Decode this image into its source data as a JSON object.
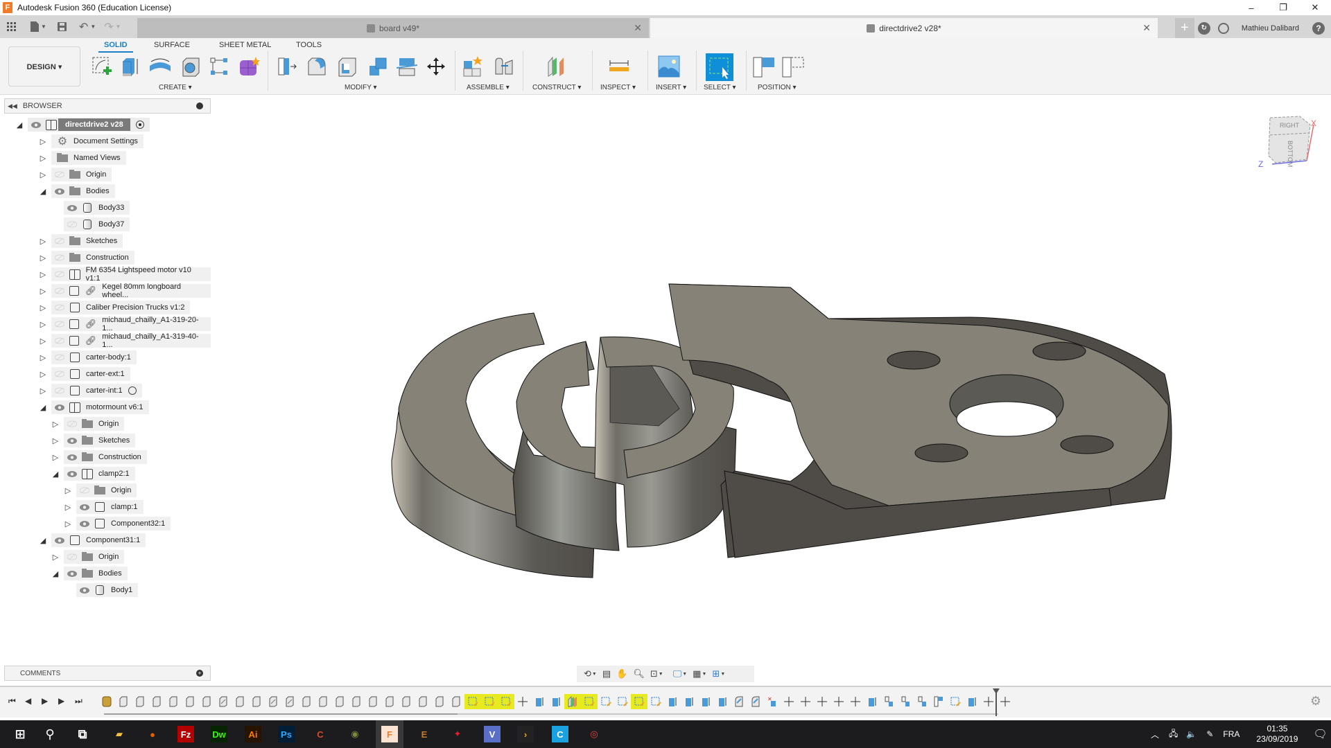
{
  "window": {
    "title": "Autodesk Fusion 360 (Education License)",
    "app_icon_letter": "F",
    "controls": {
      "minimize": "–",
      "maximize": "❐",
      "close": "✕"
    }
  },
  "tabs": [
    {
      "label": "board v49*",
      "active": false,
      "close": "✕"
    },
    {
      "label": "directdrive2 v28*",
      "active": true,
      "close": "✕"
    }
  ],
  "tabbar_right": {
    "user_name": "Mathieu Dalibard",
    "help": "?"
  },
  "toolbar": {
    "workspace": "DESIGN ▾",
    "ribbon_tabs": [
      "SOLID",
      "SURFACE",
      "SHEET METAL",
      "TOOLS"
    ],
    "active_ribbon_tab": "SOLID",
    "groups": [
      {
        "label": "CREATE ▾"
      },
      {
        "label": "MODIFY ▾"
      },
      {
        "label": "ASSEMBLE ▾"
      },
      {
        "label": "CONSTRUCT ▾"
      },
      {
        "label": "INSPECT ▾"
      },
      {
        "label": "INSERT ▾"
      },
      {
        "label": "SELECT ▾"
      },
      {
        "label": "POSITION ▾"
      }
    ]
  },
  "browser": {
    "title": "BROWSER",
    "tree": [
      {
        "label": "directdrive2 v28",
        "expanded": true,
        "visible": true,
        "icon": "assembly-icon",
        "root": true
      },
      {
        "label": "Document Settings",
        "expanded": false,
        "icon": "gear-icon"
      },
      {
        "label": "Named Views",
        "expanded": false,
        "icon": "folder-icon"
      },
      {
        "label": "Origin",
        "expanded": false,
        "visible": false,
        "icon": "folder-icon"
      },
      {
        "label": "Bodies",
        "expanded": true,
        "visible": true,
        "icon": "folder-icon"
      },
      {
        "label": "Body33",
        "visible": true,
        "icon": "body-icon"
      },
      {
        "label": "Body37",
        "visible": false,
        "icon": "body-icon"
      },
      {
        "label": "Sketches",
        "expanded": false,
        "visible": false,
        "icon": "folder-icon"
      },
      {
        "label": "Construction",
        "expanded": false,
        "visible": false,
        "icon": "folder-icon"
      },
      {
        "label": "FM 6354 Lightspeed motor v10 v1:1",
        "expanded": false,
        "visible": false,
        "icon": "assembly-icon"
      },
      {
        "label": "Kegel 80mm longboard wheel...",
        "expanded": false,
        "visible": false,
        "icon": "component-icon",
        "linked": true
      },
      {
        "label": "Caliber Precision Trucks v1:2",
        "expanded": false,
        "visible": false,
        "icon": "component-icon"
      },
      {
        "label": "michaud_chailly_A1-319-20-1...",
        "expanded": false,
        "visible": false,
        "icon": "component-icon",
        "linked": true
      },
      {
        "label": "michaud_chailly_A1-319-40-1...",
        "expanded": false,
        "visible": false,
        "icon": "component-icon",
        "linked": true
      },
      {
        "label": "carter-body:1",
        "expanded": false,
        "visible": false,
        "icon": "component-icon"
      },
      {
        "label": "carter-ext:1",
        "expanded": false,
        "visible": false,
        "icon": "component-icon"
      },
      {
        "label": "carter-int:1",
        "expanded": false,
        "visible": false,
        "icon": "component-icon",
        "radio": true
      },
      {
        "label": "motormount v6:1",
        "expanded": true,
        "visible": true,
        "icon": "assembly-icon"
      },
      {
        "label": "Origin",
        "expanded": false,
        "visible": false,
        "icon": "folder-icon"
      },
      {
        "label": "Sketches",
        "expanded": false,
        "visible": true,
        "icon": "folder-icon"
      },
      {
        "label": "Construction",
        "expanded": false,
        "visible": true,
        "icon": "folder-icon"
      },
      {
        "label": "clamp2:1",
        "expanded": true,
        "visible": true,
        "icon": "assembly-icon"
      },
      {
        "label": "Origin",
        "expanded": false,
        "visible": false,
        "icon": "folder-icon"
      },
      {
        "label": "clamp:1",
        "expanded": false,
        "visible": true,
        "icon": "component-icon"
      },
      {
        "label": "Component32:1",
        "expanded": false,
        "visible": true,
        "icon": "component-icon"
      },
      {
        "label": "Component31:1",
        "expanded": true,
        "visible": true,
        "icon": "component-icon"
      },
      {
        "label": "Origin",
        "expanded": false,
        "visible": false,
        "icon": "folder-icon"
      },
      {
        "label": "Bodies",
        "expanded": true,
        "visible": true,
        "icon": "folder-icon"
      },
      {
        "label": "Body1",
        "visible": true,
        "icon": "body-icon"
      }
    ]
  },
  "comments": {
    "title": "COMMENTS"
  },
  "viewcube": {
    "face_top": "RIGHT",
    "face_front": "BOTTOM",
    "axis_x": "X",
    "axis_z": "Z"
  },
  "taskbar": {
    "apps": [
      "Start",
      "Search",
      "Task View",
      "File Explorer",
      "Firefox",
      "FileZilla",
      "Dreamweaver",
      "Illustrator",
      "Photoshop",
      "CCleaner",
      "Owl",
      "Fusion 360",
      "E",
      "Red app",
      "V",
      "Terminal",
      "C",
      "Chrome"
    ],
    "tray": {
      "language": "FRA",
      "time": "01:35",
      "date": "23/09/2019"
    }
  },
  "colors": {
    "accent": "#1a7fc7",
    "timeline_highlight": "#e8ea20",
    "model_top": "#878277",
    "model_side_dark": "#4f4c47",
    "model_side_light": "#c8c2b4"
  }
}
